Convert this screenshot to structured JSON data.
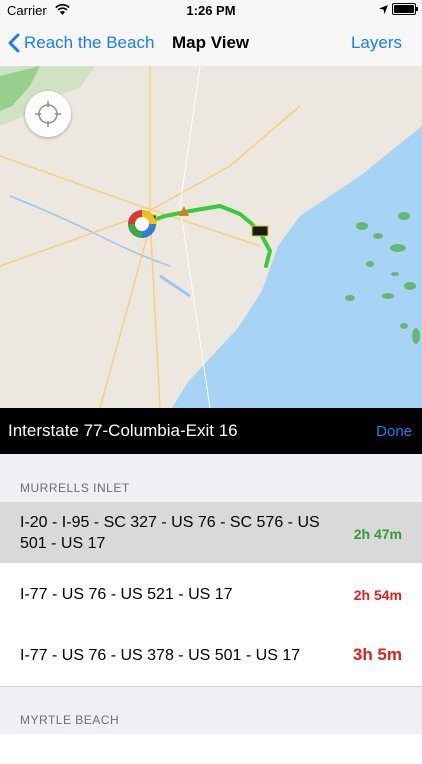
{
  "status_bar": {
    "carrier": "Carrier",
    "time": "1:26 PM"
  },
  "nav": {
    "back_label": "Reach the Beach",
    "title": "Map View",
    "layers_label": "Layers"
  },
  "info_bar": {
    "location": "Interstate 77-Columbia-Exit 16",
    "done_label": "Done"
  },
  "sections": [
    {
      "header": "MURRELLS INLET",
      "routes": [
        {
          "desc": "I-20 - I-95 - SC 327 - US 76 - SC 576 - US 501 - US 17",
          "time": "2h 47m",
          "color": "#2e9e2e"
        },
        {
          "desc": "I-77 - US 76 - US 521 - US 17",
          "time": "2h 54m",
          "color": "#e0201b"
        },
        {
          "desc": "I-77 - US 76 - US 378 - US 501 - US 17",
          "time": "3h 5m",
          "color": "#e0201b"
        }
      ]
    },
    {
      "header": "MYRTLE BEACH",
      "routes": []
    }
  ],
  "colors": {
    "accent": "#157efb",
    "route_line": "#3cc93c",
    "ocean": "#a7d3f4"
  }
}
